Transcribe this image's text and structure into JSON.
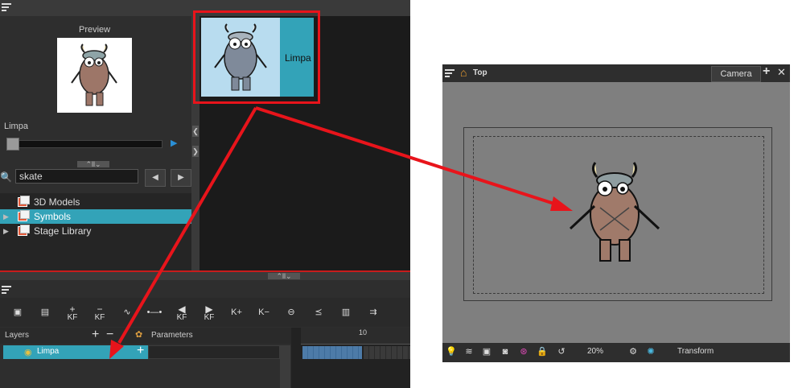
{
  "library": {
    "preview_label": "Preview",
    "symbol_name": "Limpa",
    "search_value": "skate",
    "thumbnail_label": "Limpa",
    "tree": [
      {
        "label": "3D Models",
        "expandable": false,
        "selected": false
      },
      {
        "label": "Symbols",
        "expandable": true,
        "selected": true
      },
      {
        "label": "Stage Library",
        "expandable": true,
        "selected": false
      }
    ],
    "nav_prev": "◀",
    "nav_next": "▶",
    "play": "▶"
  },
  "timeline": {
    "layers_header": "Layers",
    "parameters_header": "Parameters",
    "layer_name": "Limpa",
    "frame_marker": "10",
    "add_button": "+",
    "remove_button": "−",
    "toolbar_keyframe_label": "KF"
  },
  "camera_view": {
    "view_title": "Top",
    "tab_label": "Camera",
    "add_tab": "+",
    "close_tab": "✕",
    "zoom": "20%",
    "mode": "Transform"
  },
  "colors": {
    "panel_bg": "#2a2a2a",
    "selection_teal": "#33a3b8",
    "highlight_red": "#e8141b",
    "stage_gray": "#7f7f7f",
    "thumb_bg": "#b8dcef"
  }
}
